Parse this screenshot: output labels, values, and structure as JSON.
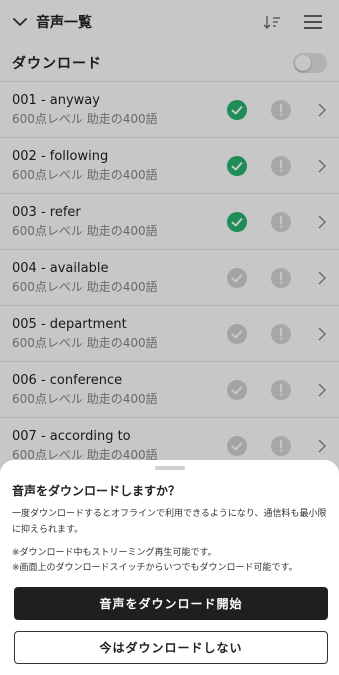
{
  "header": {
    "title": "音声一覧",
    "collapse_icon": "chevron-down-icon",
    "sort_icon": "sort-descending-icon",
    "menu_icon": "list-menu-icon"
  },
  "download": {
    "label": "ダウンロード",
    "toggle_on": false
  },
  "items": [
    {
      "title": "001 - anyway",
      "subtitle": "600点レベル 助走の400語",
      "downloaded": true
    },
    {
      "title": "002 - following",
      "subtitle": "600点レベル 助走の400語",
      "downloaded": true
    },
    {
      "title": "003 - refer",
      "subtitle": "600点レベル 助走の400語",
      "downloaded": true
    },
    {
      "title": "004 - available",
      "subtitle": "600点レベル 助走の400語",
      "downloaded": false
    },
    {
      "title": "005 - department",
      "subtitle": "600点レベル 助走の400語",
      "downloaded": false
    },
    {
      "title": "006 - conference",
      "subtitle": "600点レベル 助走の400語",
      "downloaded": false
    },
    {
      "title": "007 - according to",
      "subtitle": "600点レベル 助走の400語",
      "downloaded": false
    }
  ],
  "sheet": {
    "title": "音声をダウンロードしますか？",
    "description": "一度ダウンロードするとオフラインで利用できるようになり、通信料も最小限に抑えられます。",
    "notes": [
      "※ダウンロード中もストリーミング再生可能です。",
      "※画面上のダウンロードスイッチからいつでもダウンロード可能です。"
    ],
    "primary_label": "音声をダウンロード開始",
    "secondary_label": "今はダウンロードしない"
  },
  "colors": {
    "downloaded": "#27b56f",
    "not_downloaded": "#d3d3d3",
    "primary_button": "#1f1f1f"
  }
}
